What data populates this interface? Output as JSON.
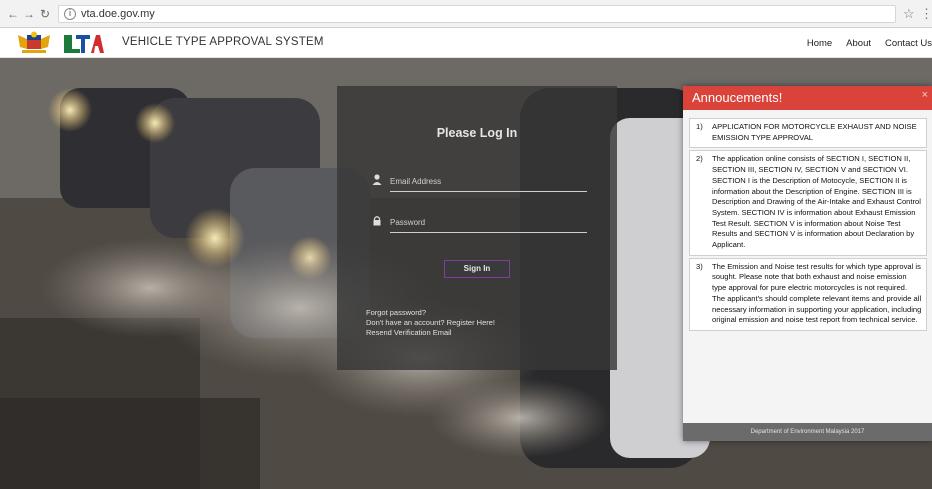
{
  "browser": {
    "back_icon": "arrow-left",
    "forward_icon": "arrow-right",
    "reload_icon": "reload",
    "info_icon": "info-circle",
    "url": "vta.doe.gov.my",
    "bookmark_icon": "star"
  },
  "header": {
    "title": "VEHICLE TYPE APPROVAL SYSTEM",
    "nav": [
      "Home",
      "About",
      "Contact Us"
    ]
  },
  "login": {
    "title": "Please Log In",
    "email_placeholder": "Email Address",
    "password_placeholder": "Password",
    "signin_label": "Sign In",
    "forgot": "Forgot password?",
    "register": "Don't have an account? Register Here!",
    "resend": "Resend Verification Email"
  },
  "announcements": {
    "title": "Annoucements!",
    "close": "×",
    "items": [
      {
        "num": "1)",
        "text": "APPLICATION FOR MOTORCYCLE EXHAUST AND NOISE EMISSION TYPE APPROVAL"
      },
      {
        "num": "2)",
        "text": "The application online consists of SECTION I, SECTION II, SECTION III, SECTION IV, SECTION V and SECTION VI. SECTION I is the Description of Motocycle, SECTION II is information about the Description of Engine. SECTION III is Description and Drawing of the Air-Intake and Exhaust Control System. SECTION IV is information about Exhaust Emission Test Result. SECTION V is information about Noise Test Results and SECTION V is information about Declaration by Applicant."
      },
      {
        "num": "3)",
        "text": "The Emission and Noise test results for which type approval is sought. Please note that both exhaust and noise emission type approval for pure electric motorcycles is not required. The applicant's should complete relevant items and provide all necessary information in supporting your application, including original emission and noise test report from technical service."
      }
    ],
    "footer": "Department of Environment Malaysia 2017"
  },
  "colors": {
    "accent_red": "#d9433a",
    "signin_border": "#7a3fa0"
  }
}
